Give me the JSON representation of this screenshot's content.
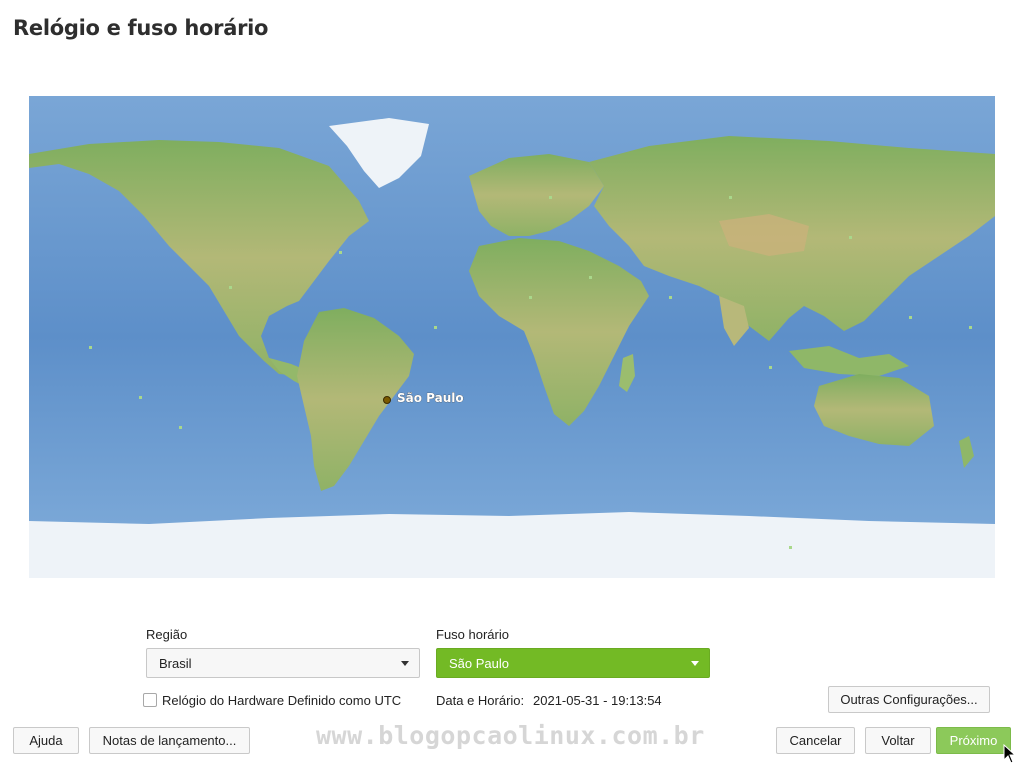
{
  "page": {
    "title": "Relógio e fuso horário"
  },
  "map": {
    "selected_city": "São Paulo",
    "ocean_color": "#5d8fc9",
    "land_color": "#8eb46a",
    "ice_color": "#eef3f8",
    "marker_color": "#7a5a00"
  },
  "region": {
    "label": "Região",
    "value": "Brasil"
  },
  "timezone": {
    "label": "Fuso horário",
    "value": "São Paulo",
    "accent": "#73ba25"
  },
  "hardware_clock": {
    "label": "Relógio do Hardware Definido como UTC",
    "checked": false
  },
  "datetime": {
    "label": "Data e Horário:",
    "value": "2021-05-31 - 19:13:54"
  },
  "buttons": {
    "other_settings": "Outras Configurações...",
    "help": "Ajuda",
    "release_notes": "Notas de lançamento...",
    "cancel": "Cancelar",
    "back": "Voltar",
    "next": "Próximo"
  },
  "watermark": "www.blogopcaolinux.com.br"
}
